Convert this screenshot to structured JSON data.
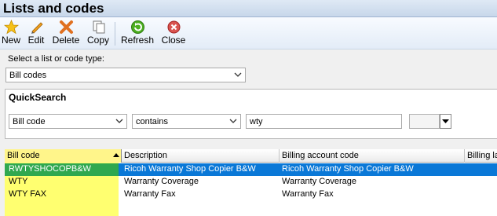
{
  "window": {
    "title": "Lists and codes"
  },
  "toolbar": {
    "new": "New",
    "edit": "Edit",
    "delete": "Delete",
    "copy": "Copy",
    "refresh": "Refresh",
    "close": "Close"
  },
  "list_type": {
    "label": "Select a list or code type:",
    "value": "Bill codes"
  },
  "quicksearch": {
    "title": "QuickSearch",
    "field": "Bill code",
    "operator": "contains",
    "text": "wty"
  },
  "grid": {
    "columns": [
      "Bill code",
      "Description",
      "Billing account code",
      "Billing lab"
    ],
    "rows": [
      {
        "bill_code": "RWTYSHOCOPB&W",
        "description": "Ricoh Warranty Shop Copier B&W",
        "billing_account": "Ricoh Warranty Shop Copier B&W"
      },
      {
        "bill_code": "WTY",
        "description": "Warranty Coverage",
        "billing_account": "Warranty Coverage"
      },
      {
        "bill_code": "WTY FAX",
        "description": "Warranty Fax",
        "billing_account": "Warranty Fax"
      }
    ]
  },
  "colors": {
    "selected_row": "#0a78d7",
    "highlight": "#ffff70",
    "highlight_selected": "#2fa84f"
  }
}
